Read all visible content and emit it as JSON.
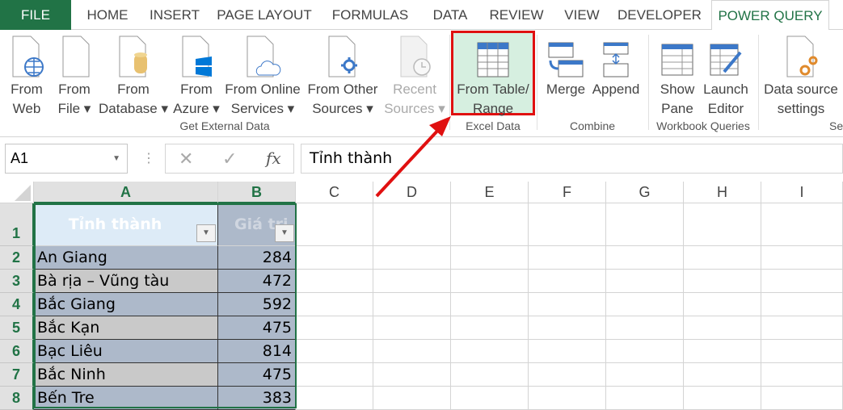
{
  "tabs": [
    "FILE",
    "HOME",
    "INSERT",
    "PAGE LAYOUT",
    "FORMULAS",
    "DATA",
    "REVIEW",
    "VIEW",
    "DEVELOPER",
    "POWER QUERY"
  ],
  "ribbon": {
    "get_external": [
      {
        "l1": "From",
        "l2": "Web"
      },
      {
        "l1": "From",
        "l2": "File ▾"
      },
      {
        "l1": "From",
        "l2": "Database ▾"
      },
      {
        "l1": "From",
        "l2": "Azure ▾"
      },
      {
        "l1": "From Online",
        "l2": "Services ▾"
      },
      {
        "l1": "From Other",
        "l2": "Sources ▾"
      },
      {
        "l1": "Recent",
        "l2": "Sources ▾"
      }
    ],
    "get_external_label": "Get External Data",
    "from_table": {
      "l1": "From Table/",
      "l2": "Range"
    },
    "excel_data_label": "Excel Data",
    "merge": "Merge",
    "append": "Append",
    "combine_label": "Combine",
    "show_pane": {
      "l1": "Show",
      "l2": "Pane"
    },
    "launch_editor": {
      "l1": "Launch",
      "l2": "Editor"
    },
    "workbook_queries_label": "Workbook Queries",
    "data_source": {
      "l1": "Data source",
      "l2": "settings"
    },
    "se_label": "Se"
  },
  "formula_bar": {
    "name_box": "A1",
    "fx": "fx",
    "content": "Tỉnh thành"
  },
  "columns": [
    "A",
    "B",
    "C",
    "D",
    "E",
    "F",
    "G",
    "H",
    "I"
  ],
  "rows": [
    "1",
    "2",
    "3",
    "4",
    "5",
    "6",
    "7",
    "8"
  ],
  "table": {
    "headers": [
      "Tỉnh thành",
      "Giá trị"
    ],
    "data": [
      [
        "An Giang",
        "284"
      ],
      [
        "Bà rịa – Vũng tàu",
        "472"
      ],
      [
        "Bắc Giang",
        "592"
      ],
      [
        "Bắc Kạn",
        "475"
      ],
      [
        "Bạc Liêu",
        "814"
      ],
      [
        "Bắc Ninh",
        "475"
      ],
      [
        "Bến Tre",
        "383"
      ]
    ]
  },
  "colors": {
    "accent": "#217346",
    "highlight": "#e01010",
    "row_a": "#adb9ca",
    "row_b": "#c9c9c9"
  }
}
